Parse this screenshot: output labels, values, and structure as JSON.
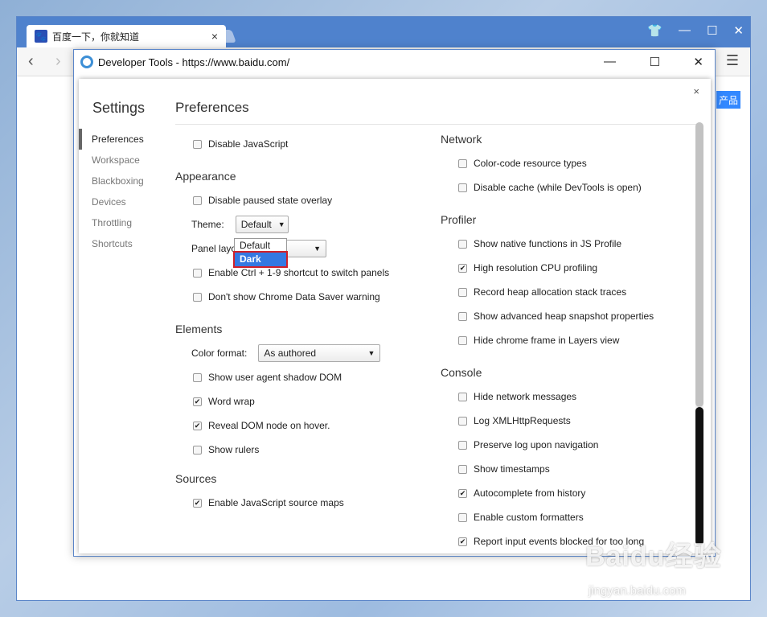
{
  "browser": {
    "tab_title": "百度一下，你就知道",
    "tab_close": "×",
    "side_badge": "产品"
  },
  "devtools": {
    "title": "Developer Tools - https://www.baidu.com/"
  },
  "settings": {
    "heading": "Settings",
    "close": "×",
    "nav": [
      "Preferences",
      "Workspace",
      "Blackboxing",
      "Devices",
      "Throttling",
      "Shortcuts"
    ],
    "active_nav": "Preferences"
  },
  "preferences": {
    "heading": "Preferences",
    "left": {
      "top_items": [
        {
          "label": "Disable JavaScript",
          "checked": false
        }
      ],
      "appearance": {
        "title": "Appearance",
        "disable_paused": {
          "label": "Disable paused state overlay",
          "checked": false
        },
        "theme_label": "Theme:",
        "theme_value": "Default",
        "theme_options": [
          "Default",
          "Dark"
        ],
        "theme_highlight": "Dark",
        "panel_layout_label": "Panel layo",
        "shortcut": {
          "label": "Enable Ctrl + 1-9 shortcut to switch panels",
          "checked": false
        },
        "data_saver": {
          "label": "Don't show Chrome Data Saver warning",
          "checked": false
        }
      },
      "elements": {
        "title": "Elements",
        "color_format_label": "Color format:",
        "color_format_value": "As authored",
        "items": [
          {
            "label": "Show user agent shadow DOM",
            "checked": false
          },
          {
            "label": "Word wrap",
            "checked": true
          },
          {
            "label": "Reveal DOM node on hover.",
            "checked": true
          },
          {
            "label": "Show rulers",
            "checked": false
          }
        ]
      },
      "sources": {
        "title": "Sources",
        "items": [
          {
            "label": "Enable JavaScript source maps",
            "checked": true
          }
        ]
      }
    },
    "right": {
      "network": {
        "title": "Network",
        "items": [
          {
            "label": "Color-code resource types",
            "checked": false
          },
          {
            "label": "Disable cache (while DevTools is open)",
            "checked": false
          }
        ]
      },
      "profiler": {
        "title": "Profiler",
        "items": [
          {
            "label": "Show native functions in JS Profile",
            "checked": false
          },
          {
            "label": "High resolution CPU profiling",
            "checked": true
          },
          {
            "label": "Record heap allocation stack traces",
            "checked": false
          },
          {
            "label": "Show advanced heap snapshot properties",
            "checked": false
          },
          {
            "label": "Hide chrome frame in Layers view",
            "checked": false
          }
        ]
      },
      "console": {
        "title": "Console",
        "items": [
          {
            "label": "Hide network messages",
            "checked": false
          },
          {
            "label": "Log XMLHttpRequests",
            "checked": false
          },
          {
            "label": "Preserve log upon navigation",
            "checked": false
          },
          {
            "label": "Show timestamps",
            "checked": false
          },
          {
            "label": "Autocomplete from history",
            "checked": true
          },
          {
            "label": "Enable custom formatters",
            "checked": false
          },
          {
            "label": "Report input events blocked for too long",
            "checked": true
          }
        ]
      }
    }
  },
  "watermark": {
    "main": "Baidu经验",
    "sub": "jingyan.baidu.com"
  }
}
